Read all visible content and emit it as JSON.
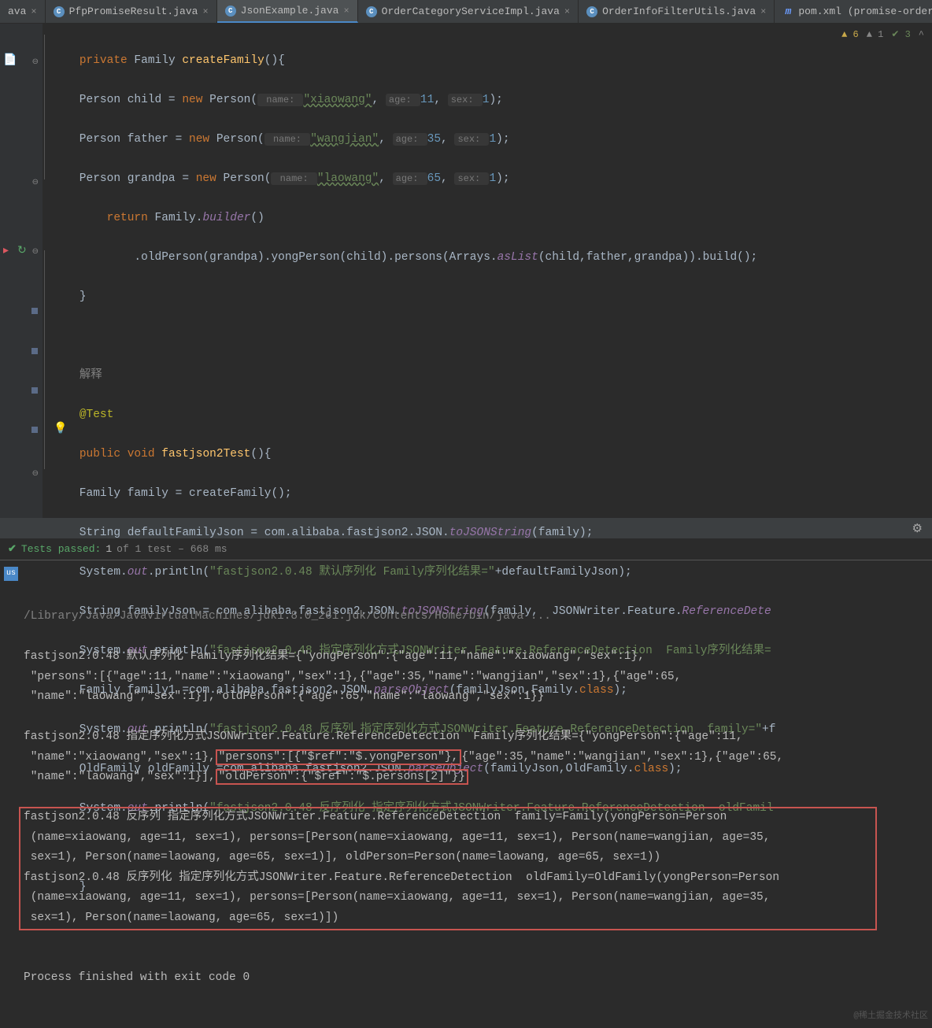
{
  "tabs": [
    {
      "label": "ava",
      "icon": ""
    },
    {
      "label": "PfpPromiseResult.java",
      "icon": "C"
    },
    {
      "label": "JsonExample.java",
      "icon": "C",
      "active": true
    },
    {
      "label": "OrderCategoryServiceImpl.java",
      "icon": "C"
    },
    {
      "label": "OrderInfoFilterUtils.java",
      "icon": "C"
    },
    {
      "label": "pom.xml (promise-ordermarking",
      "icon": "m"
    }
  ],
  "inspections": {
    "warn": "6",
    "typo": "1",
    "ok": "3"
  },
  "code": {
    "l1": {
      "kw": "private",
      "type": " Family ",
      "mtd": "createFamily",
      "rest": "(){"
    },
    "l2": {
      "p1": "    Person child = ",
      "kw": "new",
      "p2": " Person(",
      "h1": " name: ",
      "s1": "\"xiaowang\"",
      "c1": ", ",
      "h2": "age: ",
      "n1": "11",
      "c2": ", ",
      "h3": "sex: ",
      "n2": "1",
      "p3": ");"
    },
    "l3": {
      "p1": "    Person father = ",
      "kw": "new",
      "p2": " Person(",
      "h1": " name: ",
      "s1": "\"wangjian\"",
      "c1": ", ",
      "h2": "age: ",
      "n1": "35",
      "c2": ", ",
      "h3": "sex: ",
      "n2": "1",
      "p3": ");"
    },
    "l4": {
      "p1": "    Person grandpa = ",
      "kw": "new",
      "p2": " Person(",
      "h1": " name: ",
      "s1": "\"laowang\"",
      "c1": ", ",
      "h2": "age: ",
      "n1": "65",
      "c2": ", ",
      "h3": "sex: ",
      "n2": "1",
      "p3": ");"
    },
    "l5": {
      "kw": "return",
      "p1": " Family.",
      "mtd": "builder",
      "p2": "()"
    },
    "l6": {
      "p1": "            .oldPerson(grandpa).yongPerson(child).persons(Arrays.",
      "mtd": "asList",
      "p2": "(child,father,grandpa)).build();"
    },
    "l7": "}",
    "l8": "解释",
    "l9": "@Test",
    "l10": {
      "kw1": "public",
      "kw2": " void ",
      "mtd": "fastjson2Test",
      "p": "(){"
    },
    "l11": "    Family family = createFamily();",
    "l12": {
      "p1": "    String defaultFamilyJson = com.alibaba.fastjson2.JSON.",
      "mtd": "toJSONString",
      "p2": "(family);"
    },
    "l13": {
      "p1": "    System.",
      "f": "out",
      "p2": ".println(",
      "s": "\"fastjson2.0.48 默认序列化 Family序列化结果=\"",
      "p3": "+defaultFamilyJson);"
    },
    "l14": {
      "p1": "    String familyJson = com.alibaba.fastjson2.JSON.",
      "mtd": "toJSONString",
      "p2": "(family,  JSONWriter.Feature.",
      "f": "ReferenceDete"
    },
    "l15": {
      "p1": "    System.",
      "f": "out",
      "p2": ".println(",
      "s": "\"fastjson2.0.48 指定序列化方式JSONWriter.Feature.ReferenceDetection  Family序列化结果="
    },
    "l16": {
      "p1": "    Family family1 =com.alibaba.fastjson2.JSON.",
      "mtd": "parseObject",
      "p2": "(familyJson,Family.",
      "kw": "class",
      "p3": ");"
    },
    "l17": {
      "p1": "    System.",
      "f": "out",
      "p2": ".println(",
      "s": "\"fastjson2.0.48 反序列 指定序列化方式JSONWriter.Feature.ReferenceDetection  family=\"",
      "p3": "+f"
    },
    "l18": {
      "p1": "    OldFamily oldFamily =com.alibaba.fastjson2.JSON.",
      "mtd": "parseObject",
      "p2": "(familyJson,OldFamily.",
      "kw": "class",
      "p3": ");"
    },
    "l19": {
      "p1": "    System.",
      "f": "out",
      "p2": ".println(",
      "s": "\"fastjson2.0.48 反序列化 指定序列化方式JSONWriter.Feature.ReferenceDetection  oldFamil"
    },
    "l20": "}"
  },
  "testbar": {
    "pass": "Tests passed:",
    "count": " 1 ",
    "of": "of 1 test – 668 ms"
  },
  "console": {
    "cmd": "/Library/Java/JavaVirtualMachines/jdk1.8.0_261.jdk/Contents/Home/bin/java ...",
    "o1": "fastjson2.0.48 默认序列化 Family序列化结果={\"yongPerson\":{\"age\":11,\"name\":\"xiaowang\",\"sex\":1},\n \"persons\":[{\"age\":11,\"name\":\"xiaowang\",\"sex\":1},{\"age\":35,\"name\":\"wangjian\",\"sex\":1},{\"age\":65,\n \"name\":\"laowang\",\"sex\":1}],\"oldPerson\":{\"age\":65,\"name\":\"laowang\",\"sex\":1}}",
    "o2a": "fastjson2.0.48 指定序列化方式JSONWriter.Feature.ReferenceDetection  Family序列化结果={\"yongPerson\":{\"age\":11,\n \"name\":\"xiaowang\",\"sex\":1},",
    "o2b": "\"persons\":[{\"$ref\":\"$.yongPerson\"},",
    "o2c": "{\"age\":35,\"name\":\"wangjian\",\"sex\":1},{\"age\":65,\n \"name\":\"laowang\",\"sex\":1}],",
    "o2d": "\"oldPerson\":{\"$ref\":\"$.persons[2]\"}}",
    "o3": "fastjson2.0.48 反序列 指定序列化方式JSONWriter.Feature.ReferenceDetection  family=Family(yongPerson=Person\n (name=xiaowang, age=11, sex=1), persons=[Person(name=xiaowang, age=11, sex=1), Person(name=wangjian, age=35,\n sex=1), Person(name=laowang, age=65, sex=1)], oldPerson=Person(name=laowang, age=65, sex=1))\nfastjson2.0.48 反序列化 指定序列化方式JSONWriter.Feature.ReferenceDetection  oldFamily=OldFamily(yongPerson=Person\n (name=xiaowang, age=11, sex=1), persons=[Person(name=xiaowang, age=11, sex=1), Person(name=wangjian, age=35,\n sex=1), Person(name=laowang, age=65, sex=1)])",
    "exit": "Process finished with exit code 0"
  },
  "watermark": "@稀土掘金技术社区"
}
